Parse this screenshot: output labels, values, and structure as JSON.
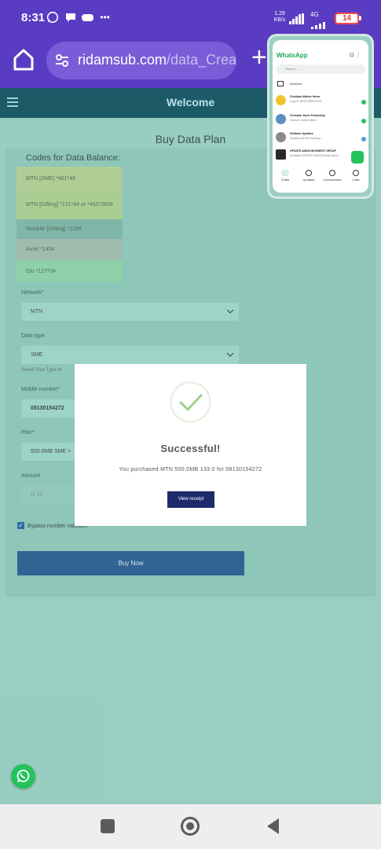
{
  "status_bar": {
    "time": "8:31",
    "network_speed_value": "1.29",
    "network_speed_unit": "KB/s",
    "network_type": "4G",
    "battery_level": "14"
  },
  "browser": {
    "url_domain": "ridamsub.com",
    "url_path": "/data_Create"
  },
  "header": {
    "title": "Welcome"
  },
  "page": {
    "heading": "Buy Data Plan"
  },
  "codes": {
    "title": "Codes for Data Balance:",
    "items": [
      {
        "text": "MTN [SME] *461*4#"
      },
      {
        "text": "MTN [Gifting] *131*4# or *460*260#"
      },
      {
        "text": "9mobile [Gifting] *228#"
      },
      {
        "text": "Airtel *140#"
      },
      {
        "text": "Glo *127*0#"
      }
    ]
  },
  "form": {
    "network_label": "Network*",
    "network_value": "MTN",
    "datatype_label": "Data type",
    "datatype_value": "SME",
    "datatype_hint": "Select Plan Type M",
    "mobile_label": "Mobile number*",
    "mobile_value": "08130154272",
    "plan_label": "Plan*",
    "plan_value": "500.0MB SME =",
    "amount_label": "Amount",
    "amount_value": "N 13",
    "bypass_label": "Bypass number validator",
    "bypass_checked": true,
    "submit_label": "Buy Now"
  },
  "modal": {
    "title": "Successful!",
    "message": "You purchased MTN 500.0MB 133.0 for 08130154272",
    "button_label": "View receipt"
  },
  "whatsapp_preview": {
    "app_name": "WhatsApp",
    "search_placeholder": "Search...",
    "archived_label": "Archived",
    "chats": [
      {
        "name": "Christian Mother Home",
        "preview": "Lucy N: BROTHERHOOD..."
      },
      {
        "name": "Christian Youth Fellowship",
        "preview": "Jenny A: At the latest..."
      },
      {
        "name": "Software Updates",
        "preview": "Update from the meeting..."
      },
      {
        "name": "UPDATE ANNOUNCEMENT GROUP",
        "preview": "Available UPDATE MASS Bundle plans..."
      }
    ],
    "tabs": [
      {
        "label": "Chats"
      },
      {
        "label": "Updates"
      },
      {
        "label": "Communities"
      },
      {
        "label": "Calls"
      }
    ]
  },
  "colors": {
    "status_bar": "#5a3cc2",
    "app_header": "#1d5a68",
    "page_bg": "#9ccfc2",
    "primary_button": "#1e4f8a",
    "modal_button": "#1e2a6b",
    "success_check": "#9fd08a",
    "whatsapp_green": "#25c25b"
  },
  "icons": {
    "status": [
      "whatsapp-icon",
      "chat-bubble-icon",
      "game-controller-icon",
      "more-dots-icon",
      "signal-icon",
      "wifi-icon",
      "battery-icon"
    ],
    "browser": [
      "home-icon",
      "site-settings-icon",
      "plus-icon"
    ],
    "app": [
      "hamburger-menu-icon",
      "chevron-down-icon",
      "checkbox-icon",
      "success-check-icon",
      "whatsapp-float-icon"
    ],
    "nav": [
      "recent-apps-icon",
      "home-circle-icon",
      "back-triangle-icon"
    ]
  }
}
